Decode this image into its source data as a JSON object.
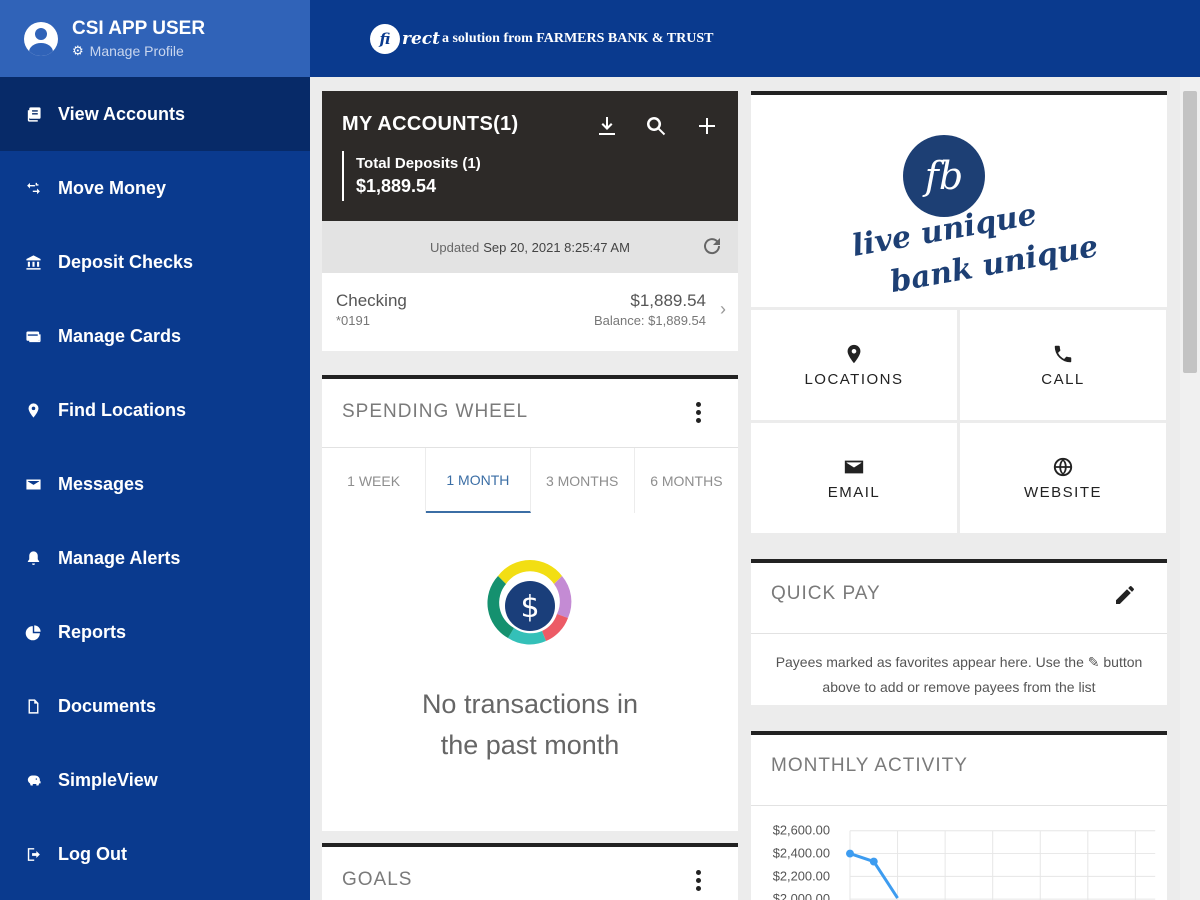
{
  "user": {
    "name": "CSI APP USER",
    "manage_profile": "Manage Profile"
  },
  "header": {
    "mark": "fi",
    "script": "rect",
    "brand": "a solution from FARMERS BANK & TRUST"
  },
  "nav": [
    {
      "label": "View Accounts",
      "icon": "accounts-icon"
    },
    {
      "label": "Move Money",
      "icon": "transfer-icon"
    },
    {
      "label": "Deposit Checks",
      "icon": "bank-icon"
    },
    {
      "label": "Manage Cards",
      "icon": "cards-icon"
    },
    {
      "label": "Find Locations",
      "icon": "location-pin-icon"
    },
    {
      "label": "Messages",
      "icon": "envelope-icon"
    },
    {
      "label": "Manage Alerts",
      "icon": "bell-icon"
    },
    {
      "label": "Reports",
      "icon": "pie-chart-icon"
    },
    {
      "label": "Documents",
      "icon": "document-icon"
    },
    {
      "label": "SimpleView",
      "icon": "piggy-bank-icon"
    },
    {
      "label": "Log Out",
      "icon": "logout-icon"
    }
  ],
  "accounts": {
    "title": "MY ACCOUNTS(1)",
    "total_label": "Total Deposits (1)",
    "total_value": "$1,889.54",
    "updated_prefix": "Updated",
    "updated_time": "Sep 20, 2021 8:25:47 AM",
    "checking": {
      "name": "Checking",
      "number": "*0191",
      "amount": "$1,889.54",
      "balance": "Balance: $1,889.54"
    }
  },
  "spending": {
    "title": "SPENDING WHEEL",
    "tabs": [
      "1 WEEK",
      "1 MONTH",
      "3 MONTHS",
      "6 MONTHS"
    ],
    "active_tab": 1,
    "empty_line1": "No transactions in",
    "empty_line2": "the past month"
  },
  "goals": {
    "title": "GOALS"
  },
  "logo": {
    "mark": "fb",
    "slogan1": "live unique",
    "slogan2": "bank unique"
  },
  "contacts": {
    "locations": "LOCATIONS",
    "call": "CALL",
    "email": "EMAIL",
    "website": "WEBSITE"
  },
  "quickpay": {
    "title": "QUICK PAY",
    "desc_before": "Payees marked as favorites appear here. Use the",
    "desc_after": "button",
    "desc_line2": "above to add or remove payees from the list"
  },
  "monthly": {
    "title": "MONTHLY ACTIVITY",
    "y_ticks": [
      "$2,600.00",
      "$2,400.00",
      "$2,200.00",
      "$2,000.00"
    ]
  },
  "colors": {
    "sidebar": "#0a3a8e",
    "accent": "#3b6ea5",
    "dark_header": "#2d2a28"
  },
  "chart_data": {
    "type": "line",
    "ylim": [
      2000,
      2600
    ],
    "y_ticks": [
      2600,
      2400,
      2200,
      2000
    ],
    "points": [
      [
        0,
        2400
      ],
      [
        1,
        2330
      ],
      [
        2,
        2010
      ]
    ]
  }
}
